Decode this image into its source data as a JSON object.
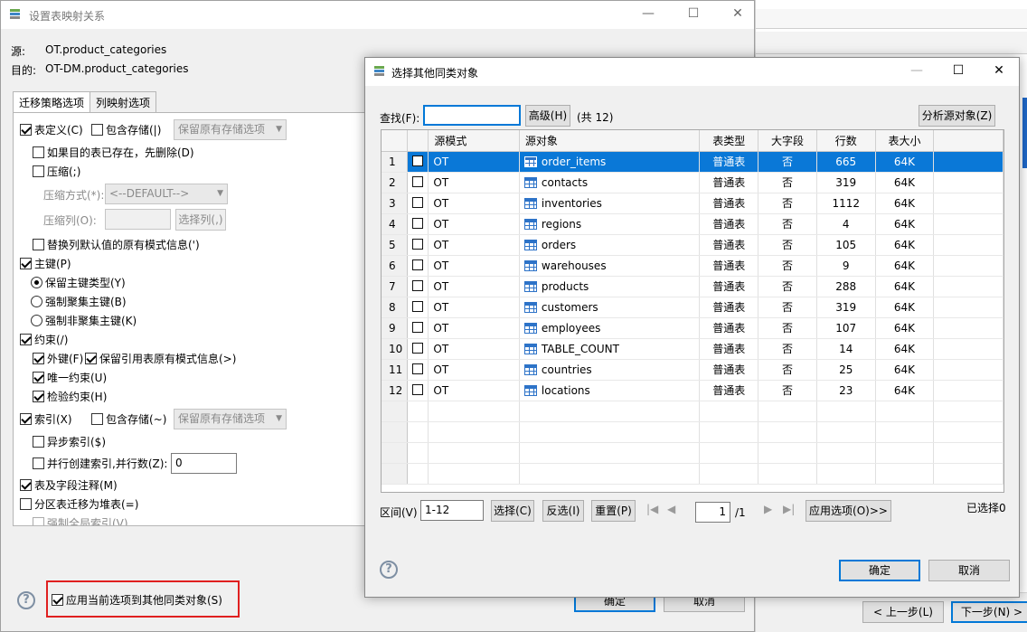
{
  "bg_window": {
    "prev_label": "< 上一步(L)",
    "next_label": "下一步(N) >"
  },
  "dialog1": {
    "title": "设置表映射关系",
    "controls": {
      "minimize": "—",
      "maximize": "☐",
      "close": "✕"
    },
    "source_label": "源:",
    "source_value": "OT.product_categories",
    "target_label": "目的:",
    "target_value": "OT-DM.product_categories",
    "tabs": [
      "迁移策略选项",
      "列映射选项"
    ],
    "options": {
      "table_def": "表定义(C)",
      "include_storage1": "包含存储(|)",
      "keep_storage_combo1": "保留原有存储选项",
      "drop_if_exists": "如果目的表已存在，先删除(D)",
      "compress": "压缩(;)",
      "compress_mode_label": "压缩方式(*):",
      "compress_mode_value": "<--DEFAULT-->",
      "compress_cols_label": "压缩列(O):",
      "select_cols_btn": "选择列(,)",
      "replace_default": "替换列默认值的原有模式信息(')",
      "primary_key": "主键(P)",
      "keep_pk_type": "保留主键类型(Y)",
      "force_clustered": "强制聚集主键(B)",
      "force_nonclustered": "强制非聚集主键(K)",
      "constraints": "约束(/)",
      "foreign_key": "外键(F)",
      "keep_ref_schema": "保留引用表原有模式信息(>)",
      "unique": "唯一约束(U)",
      "check": "检验约束(H)",
      "index": "索引(X)",
      "include_storage2": "包含存储(~)",
      "keep_storage_combo2": "保留原有存储选项",
      "async_index": "异步索引($)",
      "parallel_index": "并行创建索引,并行数(Z):",
      "parallel_value": "0",
      "comments": "表及字段注释(M)",
      "partition_heap": "分区表迁移为堆表(=)",
      "force_global_index": "强制全局索引(V)"
    },
    "apply_others": "应用当前选项到其他同类对象(S)",
    "ok_label": "确定",
    "cancel_label": "取消",
    "help": "?"
  },
  "dialog2": {
    "title": "选择其他同类对象",
    "controls": {
      "minimize": "—",
      "maximize": "☐",
      "close": "✕"
    },
    "find_label": "查找(F):",
    "find_value": "",
    "advanced_btn": "高级(H)",
    "total": "(共 12)",
    "analyze_btn": "分析源对象(Z)",
    "columns": [
      "源模式",
      "源对象",
      "表类型",
      "大字段",
      "行数",
      "表大小"
    ],
    "rows": [
      {
        "n": "1",
        "schema": "OT",
        "object": "order_items",
        "type": "普通表",
        "lob": "否",
        "rows": "665",
        "size": "64K"
      },
      {
        "n": "2",
        "schema": "OT",
        "object": "contacts",
        "type": "普通表",
        "lob": "否",
        "rows": "319",
        "size": "64K"
      },
      {
        "n": "3",
        "schema": "OT",
        "object": "inventories",
        "type": "普通表",
        "lob": "否",
        "rows": "1112",
        "size": "64K"
      },
      {
        "n": "4",
        "schema": "OT",
        "object": "regions",
        "type": "普通表",
        "lob": "否",
        "rows": "4",
        "size": "64K"
      },
      {
        "n": "5",
        "schema": "OT",
        "object": "orders",
        "type": "普通表",
        "lob": "否",
        "rows": "105",
        "size": "64K"
      },
      {
        "n": "6",
        "schema": "OT",
        "object": "warehouses",
        "type": "普通表",
        "lob": "否",
        "rows": "9",
        "size": "64K"
      },
      {
        "n": "7",
        "schema": "OT",
        "object": "products",
        "type": "普通表",
        "lob": "否",
        "rows": "288",
        "size": "64K"
      },
      {
        "n": "8",
        "schema": "OT",
        "object": "customers",
        "type": "普通表",
        "lob": "否",
        "rows": "319",
        "size": "64K"
      },
      {
        "n": "9",
        "schema": "OT",
        "object": "employees",
        "type": "普通表",
        "lob": "否",
        "rows": "107",
        "size": "64K"
      },
      {
        "n": "10",
        "schema": "OT",
        "object": "TABLE_COUNT",
        "type": "普通表",
        "lob": "否",
        "rows": "14",
        "size": "64K"
      },
      {
        "n": "11",
        "schema": "OT",
        "object": "countries",
        "type": "普通表",
        "lob": "否",
        "rows": "25",
        "size": "64K"
      },
      {
        "n": "12",
        "schema": "OT",
        "object": "locations",
        "type": "普通表",
        "lob": "否",
        "rows": "23",
        "size": "64K"
      }
    ],
    "range_label": "区间(V)",
    "range_value": "1-12",
    "select_btn": "选择(C)",
    "invert_btn": "反选(I)",
    "reset_btn": "重置(P)",
    "page_value": "1",
    "page_total": "/1",
    "apply_opts_btn": "应用选项(O)>>",
    "selected": "已选择0",
    "ok_label": "确定",
    "cancel_label": "取消",
    "help": "?"
  }
}
